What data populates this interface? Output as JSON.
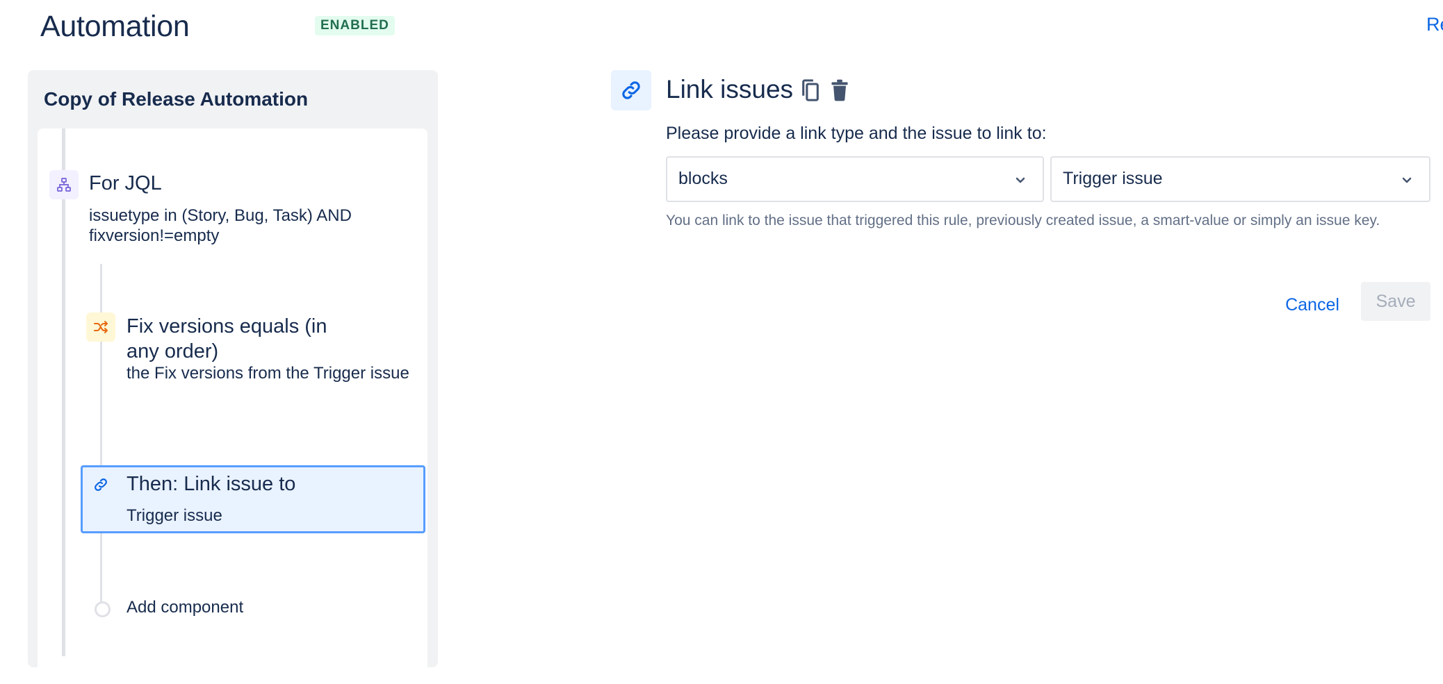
{
  "header": {
    "title": "Automation",
    "status_badge": "ENABLED",
    "right_link": "Re"
  },
  "rule": {
    "name": "Copy of Release Automation",
    "nodes": [
      {
        "type": "branch",
        "icon": "branch-hierarchy-icon",
        "title": "For JQL",
        "subtitle": "issuetype in (Story, Bug, Task) AND fixversion!=empty"
      },
      {
        "type": "condition",
        "icon": "shuffle-icon",
        "title": "Fix versions equals (in any order)",
        "subtitle": "the Fix versions from the Trigger issue"
      },
      {
        "type": "action",
        "icon": "link-icon",
        "title": "Then: Link issue to",
        "subtitle": "Trigger issue",
        "selected": true
      }
    ],
    "add_component_label": "Add component"
  },
  "detail": {
    "icon": "link-icon",
    "title": "Link issues",
    "copy_icon": "copy-icon",
    "delete_icon": "trash-icon",
    "prompt": "Please provide a link type and the issue to link to:",
    "link_type_value": "blocks",
    "issue_value": "Trigger issue",
    "help_text": "You can link to the issue that triggered this rule, previously created issue, a smart-value or simply an issue key.",
    "cancel_label": "Cancel",
    "save_label": "Save"
  },
  "colors": {
    "primary": "#0c66e4",
    "text": "#172b4d",
    "subtle_text": "#626f86",
    "badge_bg": "#e3fcef",
    "badge_text": "#216e4e",
    "selected_border": "#579dff",
    "selected_bg": "#e9f2ff",
    "branch_icon": "#8270db",
    "condition_icon": "#e56910"
  }
}
